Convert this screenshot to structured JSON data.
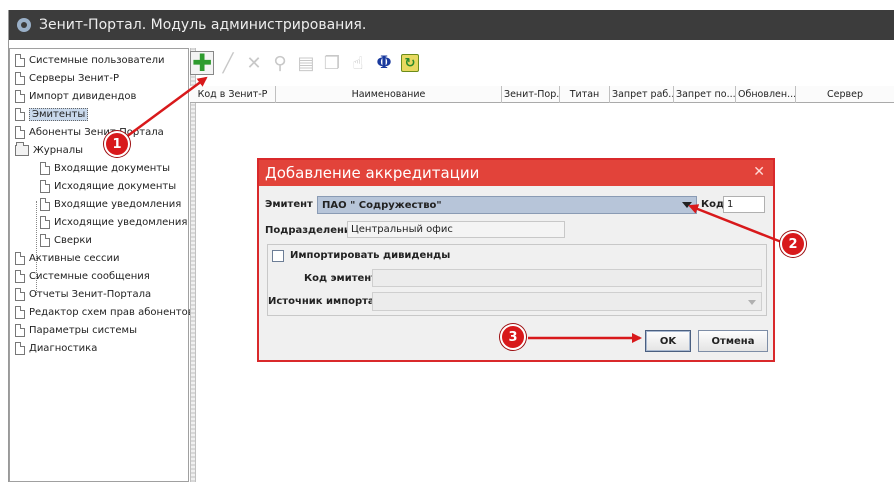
{
  "window": {
    "title": "Зенит-Портал. Модуль администрирования."
  },
  "sidebar": {
    "items": [
      {
        "label": "Системные пользователи",
        "icon": "doc-icon"
      },
      {
        "label": "Серверы Зенит-Р",
        "icon": "doc-icon"
      },
      {
        "label": "Импорт дивидендов",
        "icon": "doc-icon"
      },
      {
        "label": "Эмитенты",
        "icon": "doc-icon",
        "selected": true
      },
      {
        "label": "Абоненты Зенит-Портала",
        "icon": "doc-icon"
      },
      {
        "label": "Журналы",
        "icon": "folder-icon"
      },
      {
        "label": "Входящие документы",
        "icon": "doc-icon"
      },
      {
        "label": "Исходящие документы",
        "icon": "doc-icon"
      },
      {
        "label": "Входящие уведомления",
        "icon": "doc-icon"
      },
      {
        "label": "Исходящие уведомления",
        "icon": "doc-icon"
      },
      {
        "label": "Сверки",
        "icon": "doc-icon"
      },
      {
        "label": "Активные сессии",
        "icon": "doc-icon"
      },
      {
        "label": "Системные сообщения",
        "icon": "doc-icon"
      },
      {
        "label": "Отчеты Зенит-Портала",
        "icon": "doc-icon"
      },
      {
        "label": "Редактор схем прав абонентов",
        "icon": "doc-icon"
      },
      {
        "label": "Параметры системы",
        "icon": "doc-icon"
      },
      {
        "label": "Диагностика",
        "icon": "doc-icon"
      }
    ]
  },
  "toolbar": {
    "buttons": [
      "add-icon",
      "edit-icon",
      "delete-icon",
      "search-icon",
      "export-icon",
      "copy-icon",
      "rights-icon",
      "phi-icon",
      "refresh-icon"
    ],
    "phi_glyph": "Φ"
  },
  "grid": {
    "columns": [
      "Код в Зенит-Р",
      "Наименование",
      "Зенит-Пор...",
      "Титан",
      "Запрет раб...",
      "Запрет по...",
      "Обновлен...",
      "Сервер"
    ]
  },
  "dialog": {
    "title": "Добавление аккредитации",
    "emitent_label": "Эмитент",
    "emitent_value": "ПАО \" Содружество\"",
    "code_label": "Код",
    "code_value": "1",
    "division_label": "Подразделение",
    "division_value": "Центральный офис",
    "import_dividends_label": "Импортировать дивиденды",
    "import_dividends_checked": false,
    "emitent_code_label": "Код эмитента",
    "emitent_code_value": "",
    "import_source_label": "Источник импорта",
    "import_source_value": "",
    "ok_label": "OK",
    "cancel_label": "Отмена"
  },
  "annotations": {
    "step1": "1",
    "step2": "2",
    "step3": "3",
    "color": "#d8191b"
  }
}
